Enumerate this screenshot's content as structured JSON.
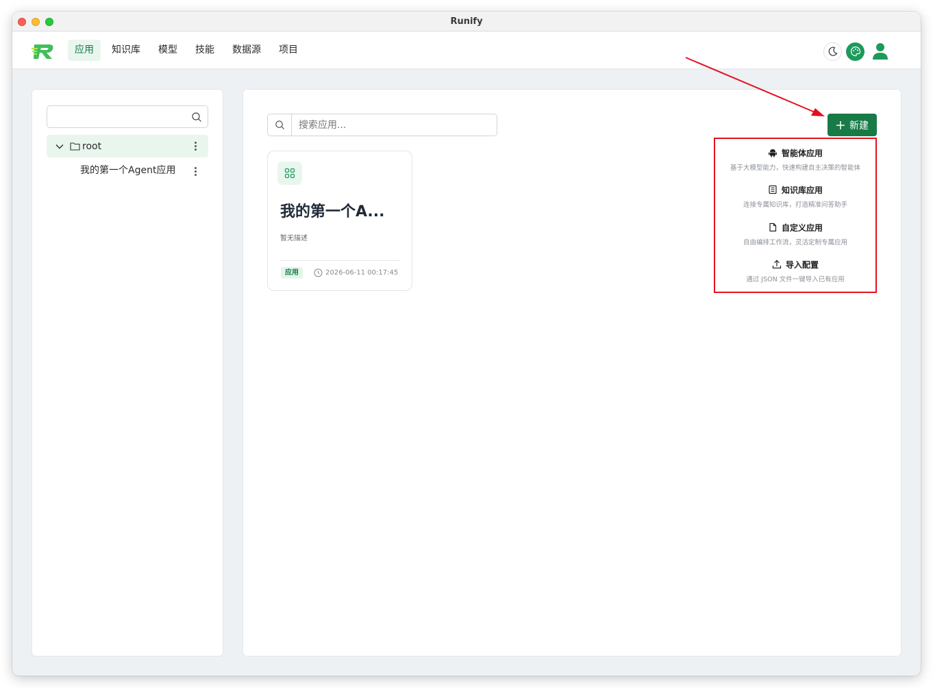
{
  "window": {
    "title": "Runify"
  },
  "nav": {
    "items": [
      {
        "label": "应用",
        "active": true
      },
      {
        "label": "知识库"
      },
      {
        "label": "模型"
      },
      {
        "label": "技能"
      },
      {
        "label": "数据源"
      },
      {
        "label": "项目"
      }
    ]
  },
  "sidebar": {
    "search_placeholder": "",
    "root_label": "root",
    "child_label": "我的第一个Agent应用"
  },
  "main": {
    "search_placeholder": "搜索应用...",
    "new_button": "新建"
  },
  "card": {
    "title": "我的第一个A...",
    "description": "暂无描述",
    "tag": "应用",
    "timestamp": "2026-06-11 00:17:45"
  },
  "dropdown": {
    "items": [
      {
        "title": "智能体应用",
        "desc": "基于大模型能力，快速构建自主决策的智能体",
        "icon": "android-icon"
      },
      {
        "title": "知识库应用",
        "desc": "连接专属知识库，打造精准问答助手",
        "icon": "document-list-icon"
      },
      {
        "title": "自定义应用",
        "desc": "自由编排工作流，灵活定制专属应用",
        "icon": "file-icon"
      },
      {
        "title": "导入配置",
        "desc": "通过 JSON 文件一键导入已有应用",
        "icon": "upload-icon"
      }
    ]
  },
  "colors": {
    "primary": "#187a47",
    "accent_light": "#e9f6ee",
    "highlight": "#e3101f"
  }
}
